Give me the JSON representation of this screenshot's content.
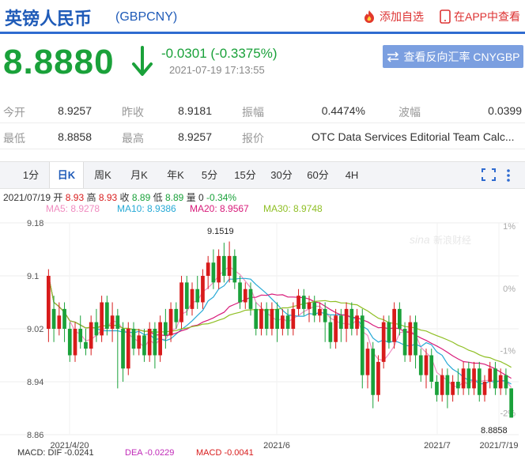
{
  "header": {
    "title": "英镑人民币",
    "code": "(GBPCNY)",
    "fav_label": "添加自选",
    "app_label": "在APP中查看"
  },
  "quote": {
    "price": "8.8880",
    "change": "-0.0301 (-0.3375%)",
    "time": "2021-07-19 17:13:55",
    "cross_button": "查看反向汇率 CNYGBP"
  },
  "stats": [
    {
      "label": "今开",
      "value": "8.9257"
    },
    {
      "label": "昨收",
      "value": "8.9181"
    },
    {
      "label": "振幅",
      "value": "0.4474%"
    },
    {
      "label": "波幅",
      "value": "0.0399"
    },
    {
      "label": "最低",
      "value": "8.8858"
    },
    {
      "label": "最高",
      "value": "8.9257"
    },
    {
      "label": "报价",
      "value": "OTC Data Services Editorial Team Calc..."
    }
  ],
  "tabs": [
    "1分",
    "日K",
    "周K",
    "月K",
    "年K",
    "5分",
    "15分",
    "30分",
    "60分",
    "4H"
  ],
  "ohlc_line": {
    "date": "2021/07/19",
    "open_label": "开",
    "open": "8.93",
    "high_label": "高",
    "high": "8.93",
    "close_label": "收",
    "close": "8.89",
    "low_label": "低",
    "low": "8.89",
    "vol_label": "量",
    "vol": "0",
    "pct": "-0.34%"
  },
  "ma_line": [
    {
      "label": "MA5: 8.9278",
      "color": "#f08cc0"
    },
    {
      "label": "MA10: 8.9386",
      "color": "#26a9d6"
    },
    {
      "label": "MA20: 8.9567",
      "color": "#d81b7a"
    },
    {
      "label": "MA30: 8.9748",
      "color": "#8fbf24"
    }
  ],
  "chart_data": {
    "type": "candlestick",
    "y_ticks": [
      "9.18",
      "9.1",
      "9.02",
      "8.94",
      "8.86"
    ],
    "right_ticks": [
      "1%",
      "0%",
      "-1%",
      "-2%"
    ],
    "x_ticks": [
      "2021/4/20",
      "2021/6",
      "2021/7",
      "2021/7/19"
    ],
    "ylim": [
      8.86,
      9.18
    ],
    "max_label": "9.1519",
    "min_label": "8.8858",
    "watermark": "新浪财经",
    "candles": [
      [
        9.02,
        9.1,
        9.11,
        9.0
      ],
      [
        9.05,
        9.02,
        9.07,
        9.0
      ],
      [
        9.02,
        9.04,
        9.06,
        9.01
      ],
      [
        9.05,
        9.02,
        9.06,
        9.0
      ],
      [
        9.02,
        8.98,
        9.03,
        8.97
      ],
      [
        8.98,
        9.02,
        9.03,
        8.97
      ],
      [
        9.02,
        9.0,
        9.04,
        8.99
      ],
      [
        9.0,
        8.99,
        9.02,
        8.98
      ],
      [
        8.99,
        9.03,
        9.04,
        8.98
      ],
      [
        9.03,
        9.01,
        9.05,
        9.0
      ],
      [
        9.01,
        9.06,
        9.07,
        9.0
      ],
      [
        9.06,
        9.02,
        9.07,
        9.01
      ],
      [
        9.02,
        9.04,
        9.06,
        9.0
      ],
      [
        9.04,
        9.02,
        9.05,
        8.93
      ],
      [
        9.02,
        8.96,
        9.03,
        8.94
      ],
      [
        8.96,
        9.02,
        9.03,
        8.95
      ],
      [
        9.02,
        8.99,
        9.03,
        8.98
      ],
      [
        8.99,
        9.01,
        9.02,
        8.98
      ],
      [
        9.01,
        8.98,
        9.02,
        8.97
      ],
      [
        8.98,
        9.02,
        9.03,
        8.97
      ],
      [
        9.02,
        8.98,
        9.03,
        8.96
      ],
      [
        8.98,
        9.03,
        9.04,
        8.97
      ],
      [
        9.03,
        9.01,
        9.05,
        8.99
      ],
      [
        9.01,
        9.05,
        9.06,
        9.0
      ],
      [
        9.05,
        9.03,
        9.06,
        9.02
      ],
      [
        9.03,
        9.09,
        9.1,
        9.02
      ],
      [
        9.09,
        9.05,
        9.1,
        9.04
      ],
      [
        9.05,
        9.08,
        9.09,
        9.04
      ],
      [
        9.08,
        9.06,
        9.1,
        9.05
      ],
      [
        9.06,
        9.1,
        9.11,
        9.05
      ],
      [
        9.1,
        9.12,
        9.13,
        9.08
      ],
      [
        9.12,
        9.09,
        9.14,
        9.08
      ],
      [
        9.09,
        9.13,
        9.14,
        9.08
      ],
      [
        9.13,
        9.1,
        9.15,
        9.09
      ],
      [
        9.1,
        9.13,
        9.1519,
        9.09
      ],
      [
        9.13,
        9.09,
        9.14,
        9.08
      ],
      [
        9.09,
        9.06,
        9.1,
        9.05
      ],
      [
        9.06,
        9.08,
        9.09,
        9.05
      ],
      [
        9.08,
        9.05,
        9.09,
        9.04
      ],
      [
        9.05,
        9.02,
        9.06,
        9.01
      ],
      [
        9.02,
        9.05,
        9.06,
        9.01
      ],
      [
        9.05,
        9.02,
        9.06,
        9.01
      ],
      [
        9.02,
        9.05,
        9.06,
        9.01
      ],
      [
        9.05,
        9.02,
        9.06,
        9.0
      ],
      [
        9.02,
        9.04,
        9.05,
        9.01
      ],
      [
        9.04,
        9.02,
        9.05,
        9.01
      ],
      [
        9.02,
        9.05,
        9.06,
        9.01
      ],
      [
        9.05,
        9.07,
        9.08,
        9.04
      ],
      [
        9.07,
        9.05,
        9.08,
        9.04
      ],
      [
        9.05,
        9.06,
        9.07,
        9.03
      ],
      [
        9.06,
        9.04,
        9.07,
        9.03
      ],
      [
        9.04,
        9.05,
        9.06,
        9.03
      ],
      [
        9.05,
        9.03,
        9.06,
        9.0
      ],
      [
        9.03,
        9.0,
        9.04,
        8.99
      ],
      [
        9.0,
        9.04,
        9.05,
        8.99
      ],
      [
        9.04,
        9.02,
        9.05,
        9.0
      ],
      [
        9.02,
        9.05,
        9.06,
        9.0
      ],
      [
        9.05,
        9.02,
        9.06,
        9.01
      ],
      [
        9.02,
        9.04,
        9.05,
        9.01
      ],
      [
        9.04,
        8.95,
        9.05,
        8.93
      ],
      [
        8.95,
        8.99,
        9.0,
        8.93
      ],
      [
        8.99,
        8.92,
        9.0,
        8.9
      ],
      [
        8.92,
        8.97,
        8.98,
        8.91
      ],
      [
        8.97,
        9.03,
        9.04,
        8.96
      ],
      [
        9.03,
        9.0,
        9.04,
        8.99
      ],
      [
        9.0,
        9.05,
        9.06,
        8.99
      ],
      [
        9.05,
        9.02,
        9.06,
        9.01
      ],
      [
        9.02,
        8.98,
        9.03,
        8.97
      ],
      [
        8.98,
        9.03,
        9.04,
        8.97
      ],
      [
        9.03,
        8.98,
        9.04,
        8.96
      ],
      [
        8.98,
        8.95,
        8.99,
        8.94
      ],
      [
        8.95,
        8.98,
        8.99,
        8.93
      ],
      [
        8.98,
        8.94,
        8.99,
        8.93
      ],
      [
        8.94,
        8.92,
        8.95,
        8.91
      ],
      [
        8.92,
        8.95,
        8.96,
        8.91
      ],
      [
        8.95,
        8.92,
        8.96,
        8.9
      ],
      [
        8.92,
        8.94,
        8.95,
        8.91
      ],
      [
        8.94,
        8.93,
        8.96,
        8.92
      ],
      [
        8.93,
        8.96,
        8.97,
        8.92
      ],
      [
        8.96,
        8.93,
        8.97,
        8.92
      ],
      [
        8.93,
        8.96,
        8.97,
        8.92
      ],
      [
        8.96,
        8.92,
        8.97,
        8.91
      ],
      [
        8.92,
        8.94,
        8.95,
        8.91
      ],
      [
        8.94,
        8.96,
        8.97,
        8.93
      ],
      [
        8.96,
        8.93,
        8.97,
        8.92
      ],
      [
        8.93,
        8.95,
        8.96,
        8.92
      ],
      [
        8.95,
        8.93,
        8.96,
        8.92
      ],
      [
        8.93,
        8.8858,
        8.93,
        8.8858
      ]
    ]
  },
  "macd_line": {
    "dif": "MACD: DIF -0.0241",
    "dea": "DEA -0.0229",
    "macd": "MACD -0.0041"
  }
}
